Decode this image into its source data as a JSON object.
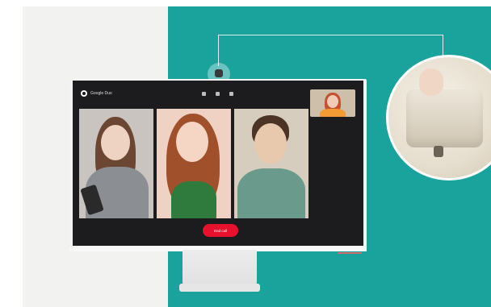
{
  "app": {
    "logo_text": "Google Duo",
    "end_call_label": "End call"
  },
  "controls": [
    {
      "name": "mic-icon"
    },
    {
      "name": "video-icon"
    },
    {
      "name": "more-icon"
    }
  ],
  "participants": [
    {
      "name": "participant-1",
      "bg": "#c9c4bf",
      "skin": "#efd3c2",
      "hair": "#6b4632",
      "shirt": "#8b8e93"
    },
    {
      "name": "participant-2",
      "bg": "#f0d2c4",
      "skin": "#f5d5c3",
      "hair": "#a0512c",
      "shirt": "#2f7a3d"
    },
    {
      "name": "participant-3",
      "bg": "#d6cdbf",
      "skin": "#e9c9ae",
      "hair": "#4b3426",
      "shirt": "#6a9a8c"
    }
  ],
  "pip_participant": {
    "bg": "#cdbfaa",
    "skin": "#f0cbb6",
    "hair": "#c4512f",
    "shirt": "#f29a34"
  },
  "colors": {
    "teal_background": "#1aa39d",
    "screen": "#1c1c1e",
    "end_call": "#e8112d"
  }
}
